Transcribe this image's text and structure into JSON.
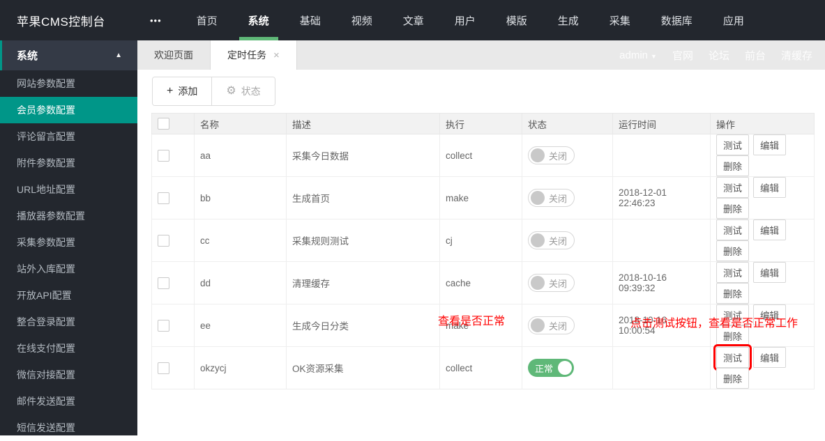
{
  "colors": {
    "accent_green": "#5FB878",
    "accent_teal": "#009688",
    "dark_bg": "#23272E",
    "annotation_red": "#FF0000"
  },
  "navbar": {
    "title": "苹果CMS控制台",
    "menu_dots": "•••",
    "items": [
      {
        "label": "首页"
      },
      {
        "label": "系统"
      },
      {
        "label": "基础"
      },
      {
        "label": "视频"
      },
      {
        "label": "文章"
      },
      {
        "label": "用户"
      },
      {
        "label": "模版"
      },
      {
        "label": "生成"
      },
      {
        "label": "采集"
      },
      {
        "label": "数据库"
      },
      {
        "label": "应用"
      }
    ],
    "active_item": "系统"
  },
  "userbar": {
    "username": "admin",
    "caret": "▼",
    "links": [
      {
        "label": "官网"
      },
      {
        "label": "论坛"
      },
      {
        "label": "前台"
      },
      {
        "label": "清缓存"
      }
    ]
  },
  "tabs": [
    {
      "label": "欢迎页面"
    },
    {
      "label": "定时任务",
      "close": "×",
      "active": true
    }
  ],
  "sidebar": {
    "header": {
      "label": "系统",
      "collapse_arrow": "▲"
    },
    "items": [
      {
        "label": "网站参数配置"
      },
      {
        "label": "会员参数配置",
        "selected": true
      },
      {
        "label": "评论留言配置"
      },
      {
        "label": "附件参数配置"
      },
      {
        "label": "URL地址配置"
      },
      {
        "label": "播放器参数配置"
      },
      {
        "label": "采集参数配置"
      },
      {
        "label": "站外入库配置"
      },
      {
        "label": "开放API配置"
      },
      {
        "label": "整合登录配置"
      },
      {
        "label": "在线支付配置"
      },
      {
        "label": "微信对接配置"
      },
      {
        "label": "邮件发送配置"
      },
      {
        "label": "短信发送配置"
      }
    ]
  },
  "toolbar": {
    "add_icon": "+",
    "add_label": "添加",
    "status_icon": "⚙",
    "status_label": "状态"
  },
  "table": {
    "headers": [
      "名称",
      "描述",
      "执行",
      "状态",
      "运行时间",
      "操作"
    ],
    "action_labels": {
      "test": "测试",
      "edit": "编辑",
      "delete": "删除"
    },
    "rows": [
      {
        "name": "aa",
        "desc": "采集今日数据",
        "exec": "collect",
        "status": {
          "state": "off",
          "label": "关闭"
        },
        "runtime": ""
      },
      {
        "name": "bb",
        "desc": "生成首页",
        "exec": "make",
        "status": {
          "state": "off",
          "label": "关闭"
        },
        "runtime": "2018-12-01 22:46:23"
      },
      {
        "name": "cc",
        "desc": "采集规则测试",
        "exec": "cj",
        "status": {
          "state": "off",
          "label": "关闭"
        },
        "runtime": ""
      },
      {
        "name": "dd",
        "desc": "清理缓存",
        "exec": "cache",
        "status": {
          "state": "off",
          "label": "关闭"
        },
        "runtime": "2018-10-16 09:39:32"
      },
      {
        "name": "ee",
        "desc": "生成今日分类",
        "exec": "make",
        "status": {
          "state": "off",
          "label": "关闭"
        },
        "runtime": "2018-10-16 10:00:54"
      },
      {
        "name": "okzycj",
        "desc": "OK资源采集",
        "exec": "collect",
        "status": {
          "state": "on",
          "label": "正常"
        },
        "runtime": ""
      }
    ]
  },
  "annotations": {
    "status_note": "查看是否正常",
    "test_note": "点击测试按钮，查看是否正常工作"
  }
}
